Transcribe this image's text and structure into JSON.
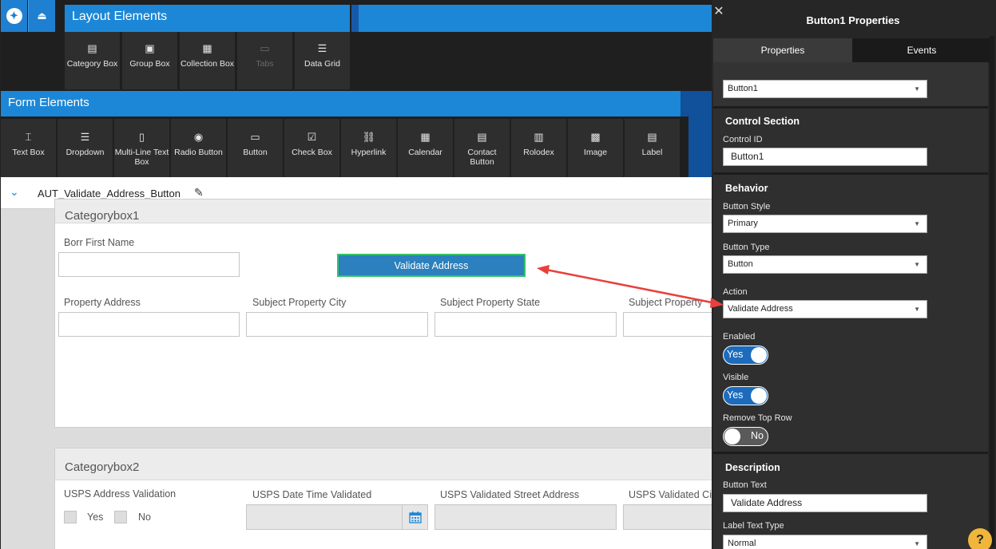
{
  "layout_elements": {
    "title": "Layout Elements",
    "tools": [
      {
        "label": "Category Box",
        "icon": "category-box-icon",
        "enabled": true
      },
      {
        "label": "Group Box",
        "icon": "group-box-icon",
        "enabled": true
      },
      {
        "label": "Collection Box",
        "icon": "collection-box-icon",
        "enabled": true
      },
      {
        "label": "Tabs",
        "icon": "tabs-icon",
        "enabled": false
      },
      {
        "label": "Data Grid",
        "icon": "data-grid-icon",
        "enabled": true
      }
    ]
  },
  "form_elements": {
    "title": "Form Elements",
    "tools": [
      {
        "label": "Text Box",
        "icon": "text-box-icon"
      },
      {
        "label": "Dropdown",
        "icon": "dropdown-icon"
      },
      {
        "label": "Multi-Line Text Box",
        "icon": "multi-line-text-box-icon"
      },
      {
        "label": "Radio Button",
        "icon": "radio-button-icon"
      },
      {
        "label": "Button",
        "icon": "button-icon"
      },
      {
        "label": "Check Box",
        "icon": "check-box-icon"
      },
      {
        "label": "Hyperlink",
        "icon": "hyperlink-icon"
      },
      {
        "label": "Calendar",
        "icon": "calendar-icon"
      },
      {
        "label": "Contact Button",
        "icon": "contact-button-icon"
      },
      {
        "label": "Rolodex",
        "icon": "rolodex-icon"
      },
      {
        "label": "Image",
        "icon": "image-icon"
      },
      {
        "label": "Label",
        "icon": "label-icon"
      }
    ]
  },
  "page": {
    "title": "AUT_Validate_Address_Button"
  },
  "categorybox1": {
    "title": "Categorybox1",
    "borr_first_name": "Borr First Name",
    "validate_button": "Validate Address",
    "property_address": "Property Address",
    "subject_city": "Subject Property City",
    "subject_state": "Subject Property State",
    "subject_zip": "Subject Property"
  },
  "categorybox2": {
    "title": "Categorybox2",
    "usps_validation": "USPS Address Validation",
    "yes": "Yes",
    "no": "No",
    "usps_date_time": "USPS Date Time Validated",
    "usps_street": "USPS Validated Street Address",
    "usps_city": "USPS Validated Ci"
  },
  "properties": {
    "title": "Button1 Properties",
    "tabs": [
      "Properties",
      "Events"
    ],
    "selected_control": "Button1",
    "control_section": {
      "heading": "Control Section",
      "control_id_label": "Control ID",
      "control_id_value": "Button1"
    },
    "behavior": {
      "heading": "Behavior",
      "button_style_label": "Button Style",
      "button_style_value": "Primary",
      "button_type_label": "Button Type",
      "button_type_value": "Button",
      "action_label": "Action",
      "action_value": "Validate Address",
      "enabled_label": "Enabled",
      "enabled_value": "Yes",
      "visible_label": "Visible",
      "visible_value": "Yes",
      "remove_top_row_label": "Remove Top Row",
      "remove_top_row_value": "No"
    },
    "description": {
      "heading": "Description",
      "button_text_label": "Button Text",
      "button_text_value": "Validate Address",
      "label_text_type_label": "Label Text Type",
      "label_text_type_value": "Normal"
    }
  },
  "help_label": "?",
  "colors": {
    "accent": "#1c87d6",
    "annotation_arrow": "#e8413c",
    "selected_outline": "#35c26a",
    "help": "#f0b63a"
  }
}
